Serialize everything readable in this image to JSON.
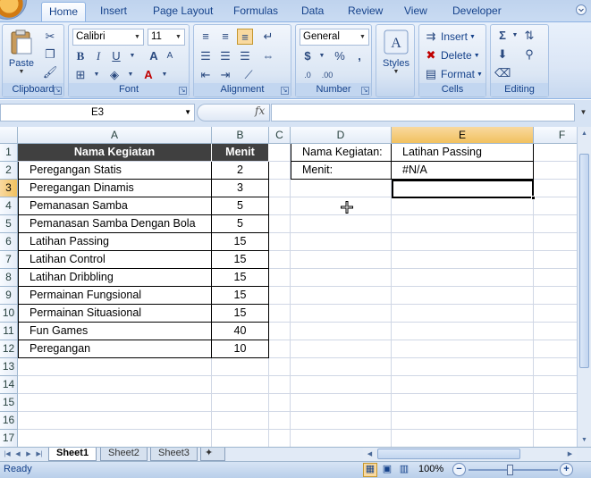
{
  "ribbon_tabs": [
    "Home",
    "Insert",
    "Page Layout",
    "Formulas",
    "Data",
    "Review",
    "View",
    "Developer"
  ],
  "active_tab": "Home",
  "groups": {
    "clipboard": {
      "label": "Clipboard",
      "paste": "Paste"
    },
    "font": {
      "label": "Font",
      "font_name": "Calibri",
      "font_size": "11"
    },
    "alignment": {
      "label": "Alignment"
    },
    "number": {
      "label": "Number",
      "format": "General"
    },
    "styles": {
      "label": "Styles"
    },
    "cells": {
      "label": "Cells",
      "insert": "Insert",
      "delete": "Delete",
      "format": "Format"
    },
    "editing": {
      "label": "Editing"
    }
  },
  "formula_bar": {
    "name_box": "E3",
    "fx": "fx",
    "formula": ""
  },
  "columns": [
    "A",
    "B",
    "C",
    "D",
    "E",
    "F"
  ],
  "rows": [
    "1",
    "2",
    "3",
    "4",
    "5",
    "6",
    "7",
    "8",
    "9",
    "10",
    "11",
    "12",
    "13",
    "14",
    "15",
    "16",
    "17"
  ],
  "table": {
    "header": {
      "name": "Nama Kegiatan",
      "minutes": "Menit"
    },
    "rows": [
      {
        "name": "Peregangan Statis",
        "minutes": "2"
      },
      {
        "name": "Peregangan Dinamis",
        "minutes": "3"
      },
      {
        "name": "Pemanasan Samba",
        "minutes": "5"
      },
      {
        "name": "Pemanasan Samba Dengan Bola",
        "minutes": "5"
      },
      {
        "name": "Latihan Passing",
        "minutes": "15"
      },
      {
        "name": "Latihan Control",
        "minutes": "15"
      },
      {
        "name": "Latihan Dribbling",
        "minutes": "15"
      },
      {
        "name": "Permainan Fungsional",
        "minutes": "15"
      },
      {
        "name": "Permainan Situasional",
        "minutes": "15"
      },
      {
        "name": "Fun Games",
        "minutes": "40"
      },
      {
        "name": "Peregangan",
        "minutes": "10"
      }
    ]
  },
  "lookup": {
    "label1": "Nama Kegiatan:",
    "value1": "Latihan Passing",
    "label2": "Menit:",
    "value2": "#N/A"
  },
  "sheets": [
    "Sheet1",
    "Sheet2",
    "Sheet3"
  ],
  "active_sheet": "Sheet1",
  "status": {
    "ready": "Ready",
    "zoom": "100%"
  }
}
